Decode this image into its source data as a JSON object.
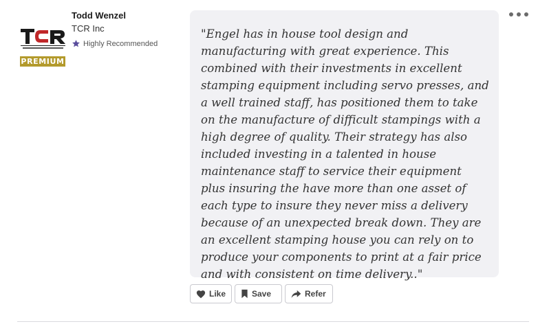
{
  "reviewer": {
    "name": "Todd Wenzel",
    "company": "TCR Inc",
    "recommendation": "Highly Recommended",
    "badge": "PREMIUM"
  },
  "logo": {
    "text": "TCR",
    "tagline": "TRANSFER & STAMPING SYSTEMS",
    "colors": {
      "primary": "#1a1a1a",
      "accent": "#c0282a"
    }
  },
  "review": {
    "quote": "\"Engel has in house tool design and manufacturing with great experience. This combined with their investments in excellent stamping equipment including servo presses, and a well trained staff, has positioned them to take on the manufacture of difficult stampings with a high degree of quality. Their strategy has also included investing in a talented in house maintenance staff to service their equipment plus insuring the have more than one asset of each type to insure they never miss a delivery because of an unexpected break down. They are an excellent stamping house you can rely on to produce your components to print at a fair price and with consistent on time delivery..\""
  },
  "actions": {
    "like": "Like",
    "save": "Save",
    "refer": "Refer"
  },
  "icons": {
    "recommend": "star-icon",
    "like": "heart-icon",
    "save": "bookmark-icon",
    "refer": "share-arrow-icon",
    "menu": "more-dots-icon"
  },
  "colors": {
    "badge": "#b39a2c",
    "star": "#5a4d9c",
    "quote_background": "#f1f1f4"
  }
}
